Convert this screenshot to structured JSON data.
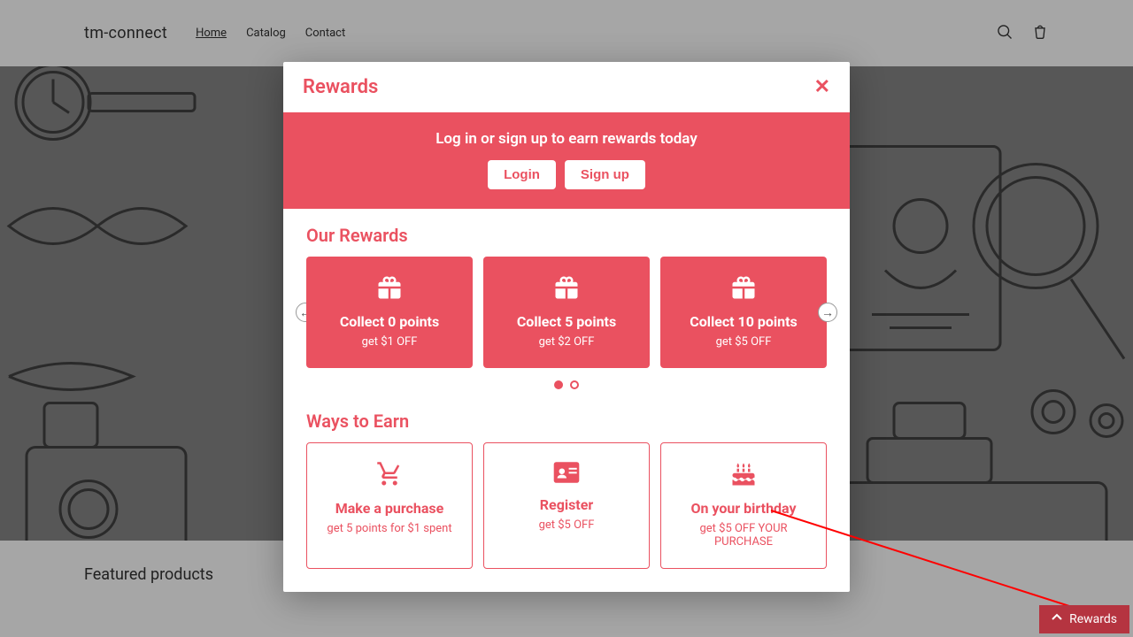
{
  "brand": "tm-connect",
  "nav": {
    "home": "Home",
    "catalog": "Catalog",
    "contact": "Contact"
  },
  "featured_heading": "Featured products",
  "modal": {
    "title": "Rewards",
    "auth_prompt": "Log in or sign up to earn rewards today",
    "login_label": "Login",
    "signup_label": "Sign up",
    "our_rewards_title": "Our Rewards",
    "ways_to_earn_title": "Ways to Earn",
    "reward_cards": [
      {
        "title": "Collect 0 points",
        "sub": "get $1 OFF"
      },
      {
        "title": "Collect 5 points",
        "sub": "get $2 OFF"
      },
      {
        "title": "Collect 10 points",
        "sub": "get $5 OFF"
      }
    ],
    "earn_cards": [
      {
        "title": "Make a purchase",
        "sub": "get 5 points for $1 spent",
        "icon": "cart"
      },
      {
        "title": "Register",
        "sub": "get $5 OFF",
        "icon": "id"
      },
      {
        "title": "On your birthday",
        "sub": "get $5 OFF YOUR PURCHASE",
        "icon": "cake"
      }
    ]
  },
  "rewards_tab_label": "Rewards",
  "colors": {
    "accent": "#ea5160"
  }
}
